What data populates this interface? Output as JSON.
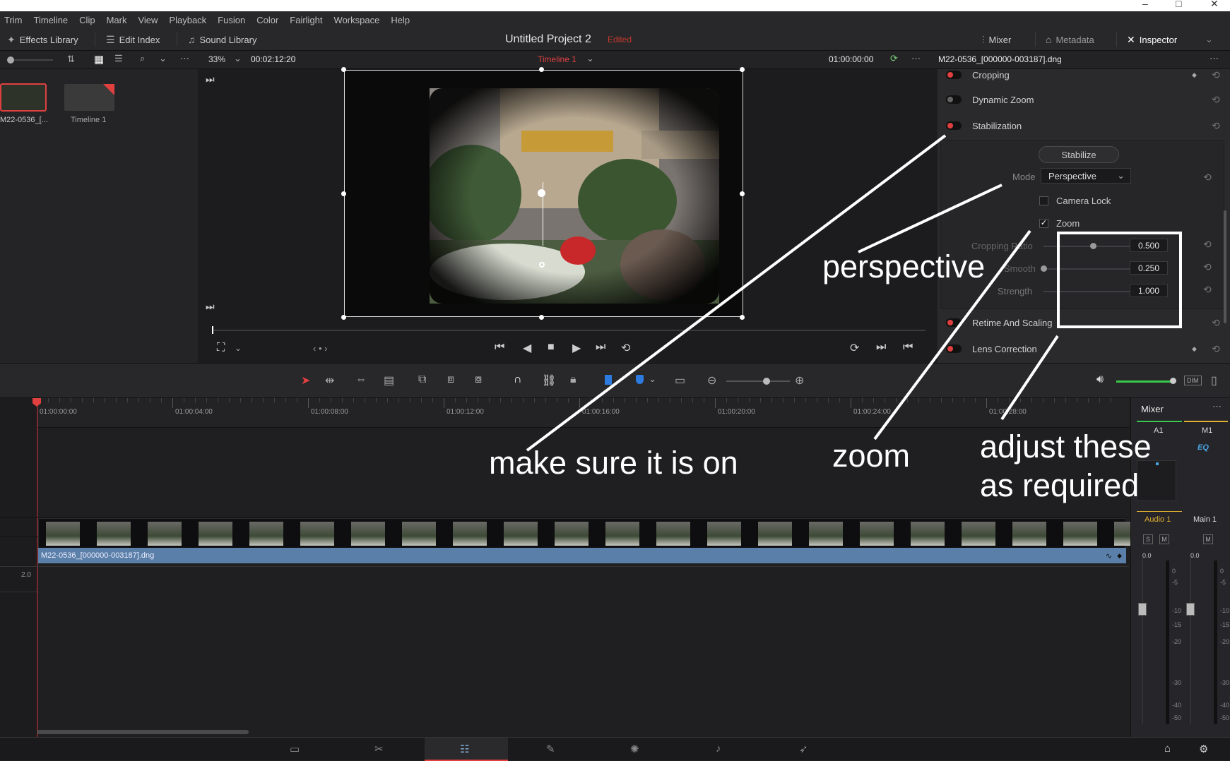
{
  "window": {
    "minimize": "–",
    "maximize": "□",
    "close": "✕"
  },
  "menu": [
    "Trim",
    "Timeline",
    "Clip",
    "Mark",
    "View",
    "Playback",
    "Fusion",
    "Color",
    "Fairlight",
    "Workspace",
    "Help"
  ],
  "toolbar": {
    "effects_library": "Effects Library",
    "edit_index": "Edit Index",
    "sound_library": "Sound Library",
    "project_title": "Untitled Project 2",
    "edited": "Edited",
    "mixer": "Mixer",
    "metadata": "Metadata",
    "inspector": "Inspector"
  },
  "subbar": {
    "zoom": "33%",
    "timecode": "00:02:12:20",
    "timeline_name": "Timeline 1",
    "timeline_tc": "01:00:00:00",
    "inspector_clip": "M22-0536_[000000-003187].dng"
  },
  "media_pool": {
    "items": [
      {
        "label": "M22-0536_[..."
      },
      {
        "label": "Timeline 1"
      }
    ]
  },
  "inspector": {
    "cropping": "Cropping",
    "dynamic_zoom": "Dynamic Zoom",
    "stabilization": "Stabilization",
    "stabilize_button": "Stabilize",
    "mode_label": "Mode",
    "mode_value": "Perspective",
    "camera_lock": "Camera Lock",
    "zoom": "Zoom",
    "cropping_ratio": "Cropping Ratio",
    "smooth": "Smooth",
    "strength": "Strength",
    "cropping_ratio_value": "0.500",
    "smooth_value": "0.250",
    "strength_value": "1.000",
    "retime": "Retime And Scaling",
    "lens": "Lens Correction",
    "camera_lock_checked": false,
    "zoom_checked": true,
    "cropping_ratio_level": 0.5,
    "smooth_level": 0,
    "strength_level": 1.0
  },
  "timeline": {
    "ruler": [
      "01:00:00:00",
      "01:00:04:00",
      "01:00:08:00",
      "01:00:12:00",
      "01:00:16:00",
      "01:00:20:00",
      "01:00:24:00",
      "01:00:28:00"
    ],
    "clip_name": "M22-0536_[000000-003187].dng",
    "audio_level": "2.0"
  },
  "mixer": {
    "title": "Mixer",
    "a1": "A1",
    "m1": "M1",
    "eq": "EQ",
    "audio1": "Audio 1",
    "main1": "Main 1",
    "s": "S",
    "m": "M",
    "level_a": "0.0",
    "level_b": "0.0",
    "scale": [
      "0",
      "-5",
      "-10",
      "-15",
      "-20",
      "-30",
      "-40",
      "-50"
    ],
    "dim": "DIM"
  },
  "annotations": {
    "perspective": "perspective",
    "make_sure": "make sure it is on",
    "zoom": "zoom",
    "adjust_line1": "adjust these",
    "adjust_line2": "as required"
  },
  "colors": {
    "accent_red": "#e04040",
    "clip_blue": "#5a7fa8",
    "mixer_yellow": "#e0b030"
  }
}
